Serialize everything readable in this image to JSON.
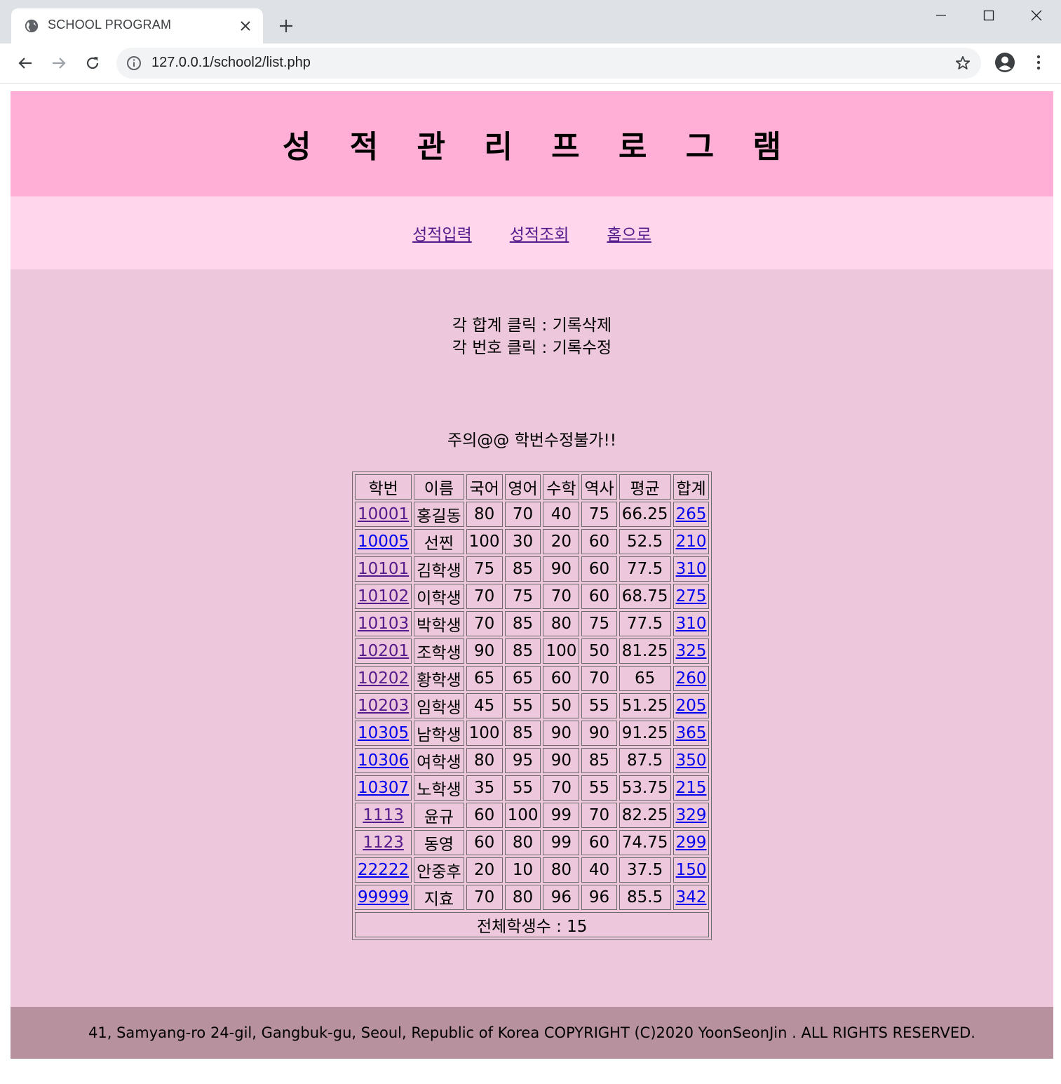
{
  "browser": {
    "tab_title": "SCHOOL PROGRAM",
    "url": "127.0.0.1/school2/list.php"
  },
  "header": {
    "title": "성 적 관 리 프 로 그 램"
  },
  "nav": {
    "items": [
      {
        "label": "성적입력"
      },
      {
        "label": "성적조회"
      },
      {
        "label": "홈으로"
      }
    ]
  },
  "notice": {
    "line1": "각 합계 클릭 : 기록삭제",
    "line2": "각 번호 클릭 : 기록수정",
    "warning": "주의@@ 학번수정불가!!"
  },
  "table": {
    "headers": [
      "학번",
      "이름",
      "국어",
      "영어",
      "수학",
      "역사",
      "평균",
      "합계"
    ],
    "rows": [
      {
        "id": "10001",
        "name": "홍길동",
        "kor": "80",
        "eng": "70",
        "math": "40",
        "hist": "75",
        "avg": "66.25",
        "sum": "265",
        "id_visited": true
      },
      {
        "id": "10005",
        "name": "선찐",
        "kor": "100",
        "eng": "30",
        "math": "20",
        "hist": "60",
        "avg": "52.5",
        "sum": "210",
        "id_visited": false
      },
      {
        "id": "10101",
        "name": "김학생",
        "kor": "75",
        "eng": "85",
        "math": "90",
        "hist": "60",
        "avg": "77.5",
        "sum": "310",
        "id_visited": true
      },
      {
        "id": "10102",
        "name": "이학생",
        "kor": "70",
        "eng": "75",
        "math": "70",
        "hist": "60",
        "avg": "68.75",
        "sum": "275",
        "id_visited": true
      },
      {
        "id": "10103",
        "name": "박학생",
        "kor": "70",
        "eng": "85",
        "math": "80",
        "hist": "75",
        "avg": "77.5",
        "sum": "310",
        "id_visited": true
      },
      {
        "id": "10201",
        "name": "조학생",
        "kor": "90",
        "eng": "85",
        "math": "100",
        "hist": "50",
        "avg": "81.25",
        "sum": "325",
        "id_visited": true
      },
      {
        "id": "10202",
        "name": "황학생",
        "kor": "65",
        "eng": "65",
        "math": "60",
        "hist": "70",
        "avg": "65",
        "sum": "260",
        "id_visited": true
      },
      {
        "id": "10203",
        "name": "임학생",
        "kor": "45",
        "eng": "55",
        "math": "50",
        "hist": "55",
        "avg": "51.25",
        "sum": "205",
        "id_visited": true
      },
      {
        "id": "10305",
        "name": "남학생",
        "kor": "100",
        "eng": "85",
        "math": "90",
        "hist": "90",
        "avg": "91.25",
        "sum": "365",
        "id_visited": false
      },
      {
        "id": "10306",
        "name": "여학생",
        "kor": "80",
        "eng": "95",
        "math": "90",
        "hist": "85",
        "avg": "87.5",
        "sum": "350",
        "id_visited": false
      },
      {
        "id": "10307",
        "name": "노학생",
        "kor": "35",
        "eng": "55",
        "math": "70",
        "hist": "55",
        "avg": "53.75",
        "sum": "215",
        "id_visited": false
      },
      {
        "id": "1113",
        "name": "윤규",
        "kor": "60",
        "eng": "100",
        "math": "99",
        "hist": "70",
        "avg": "82.25",
        "sum": "329",
        "id_visited": true
      },
      {
        "id": "1123",
        "name": "동영",
        "kor": "60",
        "eng": "80",
        "math": "99",
        "hist": "60",
        "avg": "74.75",
        "sum": "299",
        "id_visited": true
      },
      {
        "id": "22222",
        "name": "안중후",
        "kor": "20",
        "eng": "10",
        "math": "80",
        "hist": "40",
        "avg": "37.5",
        "sum": "150",
        "id_visited": false
      },
      {
        "id": "99999",
        "name": "지효",
        "kor": "70",
        "eng": "80",
        "math": "96",
        "hist": "96",
        "avg": "85.5",
        "sum": "342",
        "id_visited": false
      }
    ],
    "total_label": "전체학생수 : 15"
  },
  "footer": {
    "text": "41, Samyang-ro 24-gil, Gangbuk-gu, Seoul, Republic of Korea COPYRIGHT (C)2020 YoonSeonJin . ALL RIGHTS RESERVED."
  },
  "colors": {
    "header_bg": "#ffafd6",
    "nav_bg": "#ffd6ec",
    "main_bg": "#edc7db",
    "footer_bg": "#b8919f",
    "link_visited": "#551a8b",
    "link_unvisited": "#0000ee"
  }
}
